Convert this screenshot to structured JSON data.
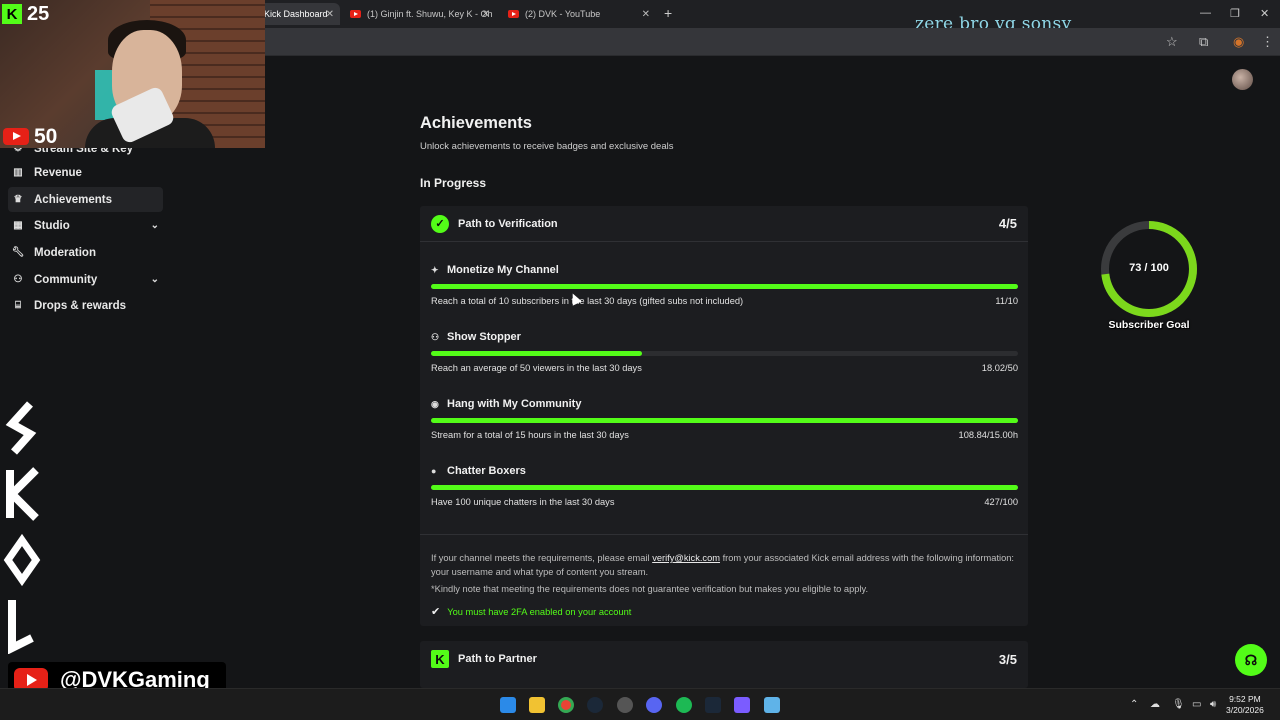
{
  "browser": {
    "tabs": [
      {
        "label": "Kick Dashboard",
        "active": true
      },
      {
        "label": "(1) Ginjin ft. Shuwu, Key K - Oh",
        "active": false
      },
      {
        "label": "(2) DVK - YouTube",
        "active": false
      }
    ],
    "new_tab": "+",
    "overlay_text": "zere bro vg sonsy"
  },
  "stream_overlay": {
    "kick_count": "25",
    "youtube_count": "50",
    "youtube_handle": "@DVKGaming",
    "subscriber_goal": {
      "current": 73,
      "target": 100,
      "display": "73 / 100",
      "label": "Subscriber Goal",
      "ring_color": "#7cd81c"
    }
  },
  "sidebar": {
    "partial_item": "Stream Site & Key",
    "items": [
      {
        "label": "Revenue",
        "icon": "chart-icon",
        "active": false,
        "expandable": false
      },
      {
        "label": "Achievements",
        "icon": "trophy-icon",
        "active": true,
        "expandable": false
      },
      {
        "label": "Studio",
        "icon": "studio-icon",
        "active": false,
        "expandable": true
      },
      {
        "label": "Moderation",
        "icon": "wrench-icon",
        "active": false,
        "expandable": false
      },
      {
        "label": "Community",
        "icon": "people-icon",
        "active": false,
        "expandable": true
      },
      {
        "label": "Drops & rewards",
        "icon": "gift-icon",
        "active": false,
        "expandable": false
      }
    ]
  },
  "page": {
    "title": "Achievements",
    "subtitle": "Unlock achievements to receive badges and exclusive deals",
    "section": "In Progress"
  },
  "verification": {
    "title": "Path to Verification",
    "score": "4/5",
    "tasks": [
      {
        "name": "Monetize My Channel",
        "icon": "sparkle-icon",
        "desc": "Reach a total of 10 subscribers in the last 30 days (gifted subs not included)",
        "value": "11/10",
        "progress": 1.0
      },
      {
        "name": "Show Stopper",
        "icon": "viewers-icon",
        "desc": "Reach an average of 50 viewers in the last 30 days",
        "value": "18.02/50",
        "progress": 0.36
      },
      {
        "name": "Hang with My Community",
        "icon": "broadcast-icon",
        "desc": "Stream for a total of 15 hours in the last 30 days",
        "value": "108.84/15.00h",
        "progress": 1.0
      },
      {
        "name": "Chatter Boxers",
        "icon": "chat-icon",
        "desc": "Have 100 unique chatters in the last 30 days",
        "value": "427/100",
        "progress": 1.0
      }
    ],
    "info_pre": "If your channel meets the requirements, please email ",
    "info_email": "verify@kick.com",
    "info_post": " from your associated Kick email address with the following information: your username and what type of content you stream.",
    "note": "*Kindly note that meeting the requirements does not guarantee verification but makes you eligible to apply.",
    "requirement": "You must have 2FA enabled on your account"
  },
  "partner": {
    "title": "Path to Partner",
    "score": "3/5"
  },
  "taskbar": {
    "time": "9:52 PM",
    "date": "3/20/2026"
  },
  "colors": {
    "accent": "#53fc18",
    "background": "#141517",
    "card": "#1c1d20"
  }
}
